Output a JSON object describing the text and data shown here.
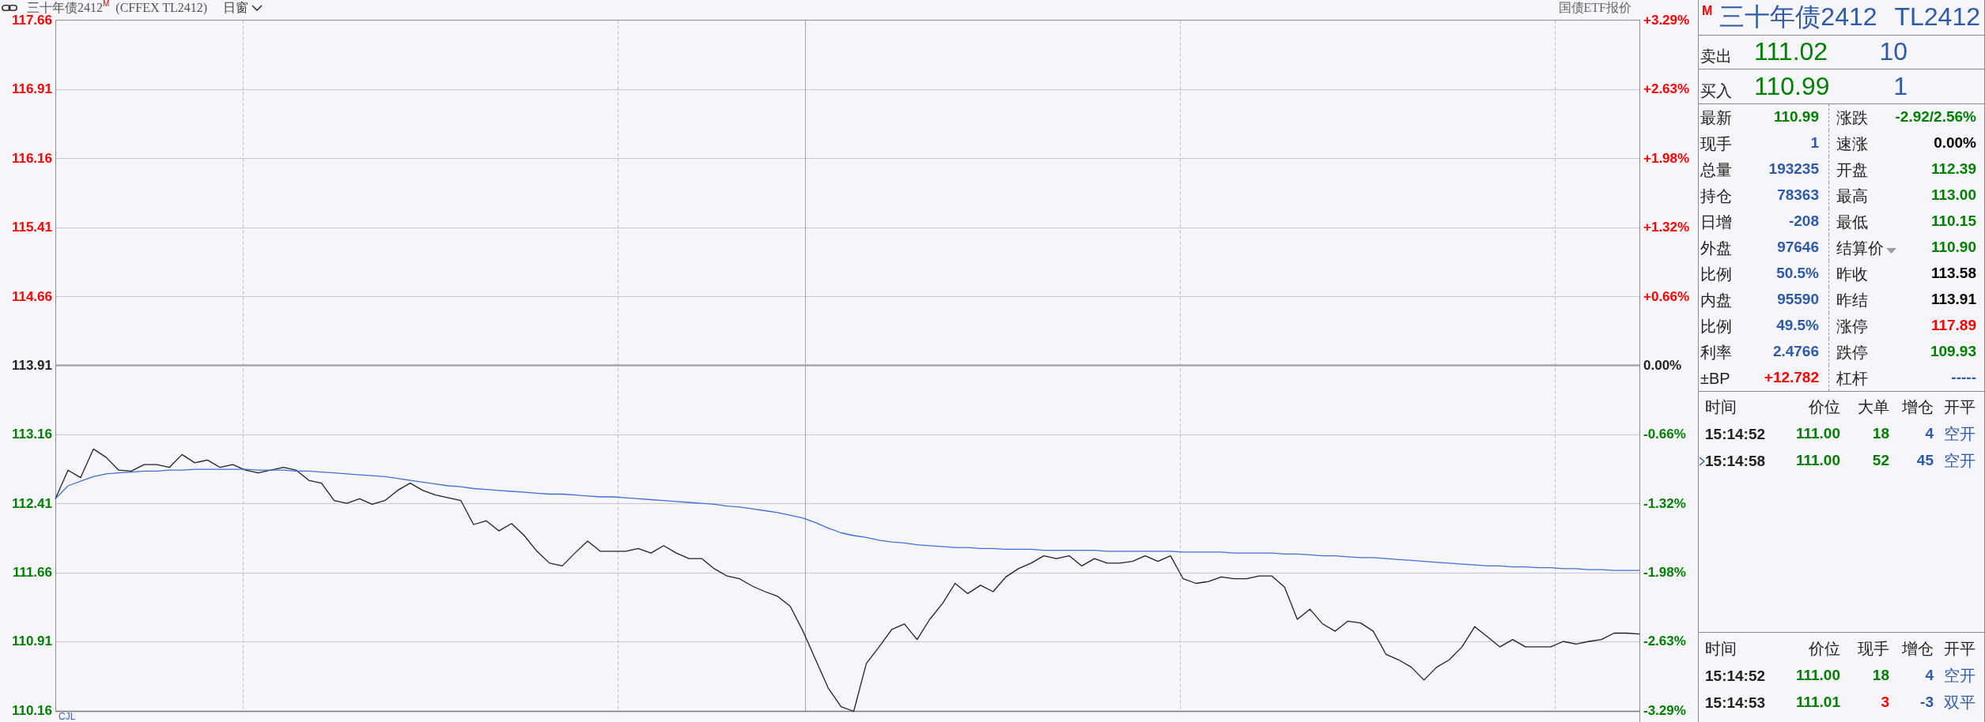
{
  "header": {
    "title": "三十年债2412$^{M}$",
    "code": "(CFFEX TL2412)",
    "period": "日窗",
    "link": "国债ETF报价"
  },
  "chart": {
    "chart_data": {
      "type": "line",
      "ylim": [
        110.15,
        117.66
      ],
      "yticks": [
        {
          "value": 117.66,
          "label": "117.66"
        },
        {
          "value": 116.91,
          "label": "116.91"
        },
        {
          "value": 116.16,
          "label": "116.16"
        },
        {
          "value": 115.41,
          "label": "115.41"
        },
        {
          "value": 114.66,
          "label": "114.66"
        },
        {
          "value": 113.91,
          "label": "113.91"
        },
        {
          "value": 113.16,
          "label": "113.16"
        },
        {
          "value": 112.41,
          "label": "112.41"
        },
        {
          "value": 111.66,
          "label": "111.66"
        },
        {
          "value": 110.91,
          "label": "110.91"
        },
        {
          "value": 110.16,
          "label": "110.16"
        }
      ],
      "grid": true,
      "series": [
        {
          "color": "#222222",
          "values": [
            112.46,
            112.77,
            112.69,
            113.0,
            112.91,
            112.77,
            112.76,
            112.83,
            112.83,
            112.8,
            112.94,
            112.85,
            112.88,
            112.8,
            112.83,
            112.77,
            112.74,
            112.77,
            112.8,
            112.77,
            112.66,
            112.63,
            112.44,
            112.41,
            112.46,
            112.4,
            112.44,
            112.55,
            112.63,
            112.55,
            112.5,
            112.47,
            112.44,
            112.18,
            112.22,
            112.11,
            112.19,
            112.06,
            111.89,
            111.76,
            111.73,
            111.87,
            112.0,
            111.89,
            111.89,
            111.89,
            111.92,
            111.87,
            111.95,
            111.87,
            111.81,
            111.81,
            111.7,
            111.62,
            111.59,
            111.51,
            111.45,
            111.4,
            111.29,
            111.02,
            110.71,
            110.4,
            110.2,
            110.15,
            110.67,
            110.85,
            111.04,
            111.1,
            110.93,
            111.15,
            111.32,
            111.54,
            111.43,
            111.52,
            111.45,
            111.61,
            111.7,
            111.76,
            111.84,
            111.81,
            111.84,
            111.73,
            111.81,
            111.76,
            111.76,
            111.78,
            111.84,
            111.78,
            111.84,
            111.59,
            111.54,
            111.56,
            111.61,
            111.59,
            111.59,
            111.62,
            111.62,
            111.5,
            111.15,
            111.26,
            111.1,
            111.02,
            111.13,
            111.11,
            111.02,
            110.77,
            110.71,
            110.63,
            110.49,
            110.63,
            110.71,
            110.85,
            111.07,
            110.96,
            110.85,
            110.93,
            110.85,
            110.85,
            110.85,
            110.91,
            110.88,
            110.91,
            110.93,
            111.0,
            111.0,
            110.99
          ]
        },
        {
          "color": "#3f6fd8",
          "values": [
            112.46,
            112.6,
            112.65,
            112.7,
            112.73,
            112.74,
            112.75,
            112.76,
            112.76,
            112.77,
            112.77,
            112.78,
            112.78,
            112.78,
            112.78,
            112.78,
            112.77,
            112.77,
            112.77,
            112.76,
            112.76,
            112.75,
            112.74,
            112.73,
            112.72,
            112.71,
            112.7,
            112.68,
            112.66,
            112.64,
            112.62,
            112.6,
            112.59,
            112.57,
            112.56,
            112.55,
            112.54,
            112.53,
            112.52,
            112.51,
            112.51,
            112.5,
            112.49,
            112.48,
            112.48,
            112.47,
            112.46,
            112.45,
            112.44,
            112.43,
            112.42,
            112.41,
            112.4,
            112.38,
            112.37,
            112.35,
            112.33,
            112.31,
            112.28,
            112.25,
            112.2,
            112.14,
            112.09,
            112.06,
            112.04,
            112.01,
            111.99,
            111.98,
            111.96,
            111.95,
            111.94,
            111.93,
            111.93,
            111.92,
            111.92,
            111.91,
            111.91,
            111.91,
            111.9,
            111.9,
            111.9,
            111.9,
            111.9,
            111.89,
            111.89,
            111.89,
            111.89,
            111.89,
            111.89,
            111.88,
            111.88,
            111.88,
            111.88,
            111.87,
            111.87,
            111.87,
            111.87,
            111.86,
            111.86,
            111.85,
            111.84,
            111.84,
            111.83,
            111.82,
            111.82,
            111.81,
            111.8,
            111.79,
            111.78,
            111.77,
            111.76,
            111.75,
            111.74,
            111.73,
            111.73,
            111.72,
            111.72,
            111.71,
            111.71,
            111.7,
            111.7,
            111.69,
            111.69,
            111.68,
            111.68,
            111.68
          ]
        }
      ],
      "ref_lines": [
        {
          "axis": "y",
          "value": 113.91,
          "color": "#a6a6ae"
        }
      ]
    },
    "right_axis_labels": [
      {
        "text": "+3.29%",
        "color": "#ff0000"
      },
      {
        "text": "+2.63%",
        "color": "#ff0000"
      },
      {
        "text": "+1.98%",
        "color": "#ff0000"
      },
      {
        "text": "+1.32%",
        "color": "#ff0000"
      },
      {
        "text": "+0.66%",
        "color": "#ff0000"
      },
      {
        "text": "0.00%",
        "color": "#222222"
      },
      {
        "text": "-0.66%",
        "color": "#008000"
      },
      {
        "text": "-1.32%",
        "color": "#008000"
      },
      {
        "text": "-1.98%",
        "color": "#008000"
      },
      {
        "text": "-2.63%",
        "color": "#008000"
      },
      {
        "text": "-3.29%",
        "color": "#008000"
      }
    ],
    "indicator": "CJL"
  },
  "quote_panel": {
    "flag": "M",
    "name": "三十年债2412",
    "code": "TL2412",
    "quotes": [
      {
        "label": "卖出",
        "price": "111.02",
        "volume": "10"
      },
      {
        "label": "买入",
        "price": "110.99",
        "volume": "1"
      }
    ],
    "stats": [
      {
        "label": "最新",
        "value": "110.99",
        "color": "#008000"
      },
      {
        "label": "涨跌",
        "value": "-2.92/2.56%",
        "color": "#008000"
      },
      {
        "label": "现手",
        "value": "1",
        "color": "#2e5aa8"
      },
      {
        "label": "速涨",
        "value": "0.00%",
        "color": "#000000"
      },
      {
        "label": "总量",
        "value": "193235",
        "color": "#2e5aa8"
      },
      {
        "label": "开盘",
        "value": "112.39",
        "color": "#008000"
      },
      {
        "label": "持仓",
        "value": "78363",
        "color": "#2e5aa8"
      },
      {
        "label": "最高",
        "value": "113.00",
        "color": "#008000"
      },
      {
        "label": "日增",
        "value": "-208",
        "color": "#2e5aa8"
      },
      {
        "label": "最低",
        "value": "110.15",
        "color": "#008000"
      },
      {
        "label": "外盘",
        "value": "97646",
        "color": "#2e5aa8"
      },
      {
        "label": "结算价",
        "value": "110.90",
        "color": "#008000",
        "dropdown": true
      },
      {
        "label": "比例",
        "value": "50.5%",
        "color": "#2e5aa8"
      },
      {
        "label": "昨收",
        "value": "113.58",
        "color": "#000000"
      },
      {
        "label": "内盘",
        "value": "95590",
        "color": "#2e5aa8"
      },
      {
        "label": "昨结",
        "value": "113.91",
        "color": "#000000"
      },
      {
        "label": "比例",
        "value": "49.5%",
        "color": "#2e5aa8"
      },
      {
        "label": "涨停",
        "value": "117.89",
        "color": "#ff0000"
      },
      {
        "label": "利率",
        "value": "2.4766",
        "color": "#2e5aa8"
      },
      {
        "label": "跌停",
        "value": "109.93",
        "color": "#008000"
      },
      {
        "label": "±BP",
        "value": "+12.782",
        "color": "#ff0000"
      },
      {
        "label": "杠杆",
        "value": "-----",
        "color": "#2e5aa8"
      }
    ]
  },
  "trade_tables": [
    {
      "columns": [
        "时间",
        "价位",
        "大单",
        "增仓",
        "开平"
      ],
      "rows": [
        {
          "time": "15:14:52",
          "price": "111.00",
          "volume": {
            "text": "18",
            "color": "#008000"
          },
          "oi_change": "4",
          "action": "空开",
          "marked": false
        },
        {
          "time": "15:14:58",
          "price": "111.00",
          "volume": {
            "text": "52",
            "color": "#008000"
          },
          "oi_change": "45",
          "action": "空开",
          "marked": true
        }
      ]
    },
    {
      "columns": [
        "时间",
        "价位",
        "现手",
        "增仓",
        "开平"
      ],
      "rows": [
        {
          "time": "15:14:52",
          "price": "111.00",
          "volume": {
            "text": "18",
            "color": "#008000"
          },
          "oi_change": "4",
          "action": "空开"
        },
        {
          "time": "15:14:53",
          "price": "111.01",
          "volume": {
            "text": "3",
            "color": "#ff0000"
          },
          "oi_change": "-3",
          "action": "双平"
        }
      ]
    }
  ]
}
